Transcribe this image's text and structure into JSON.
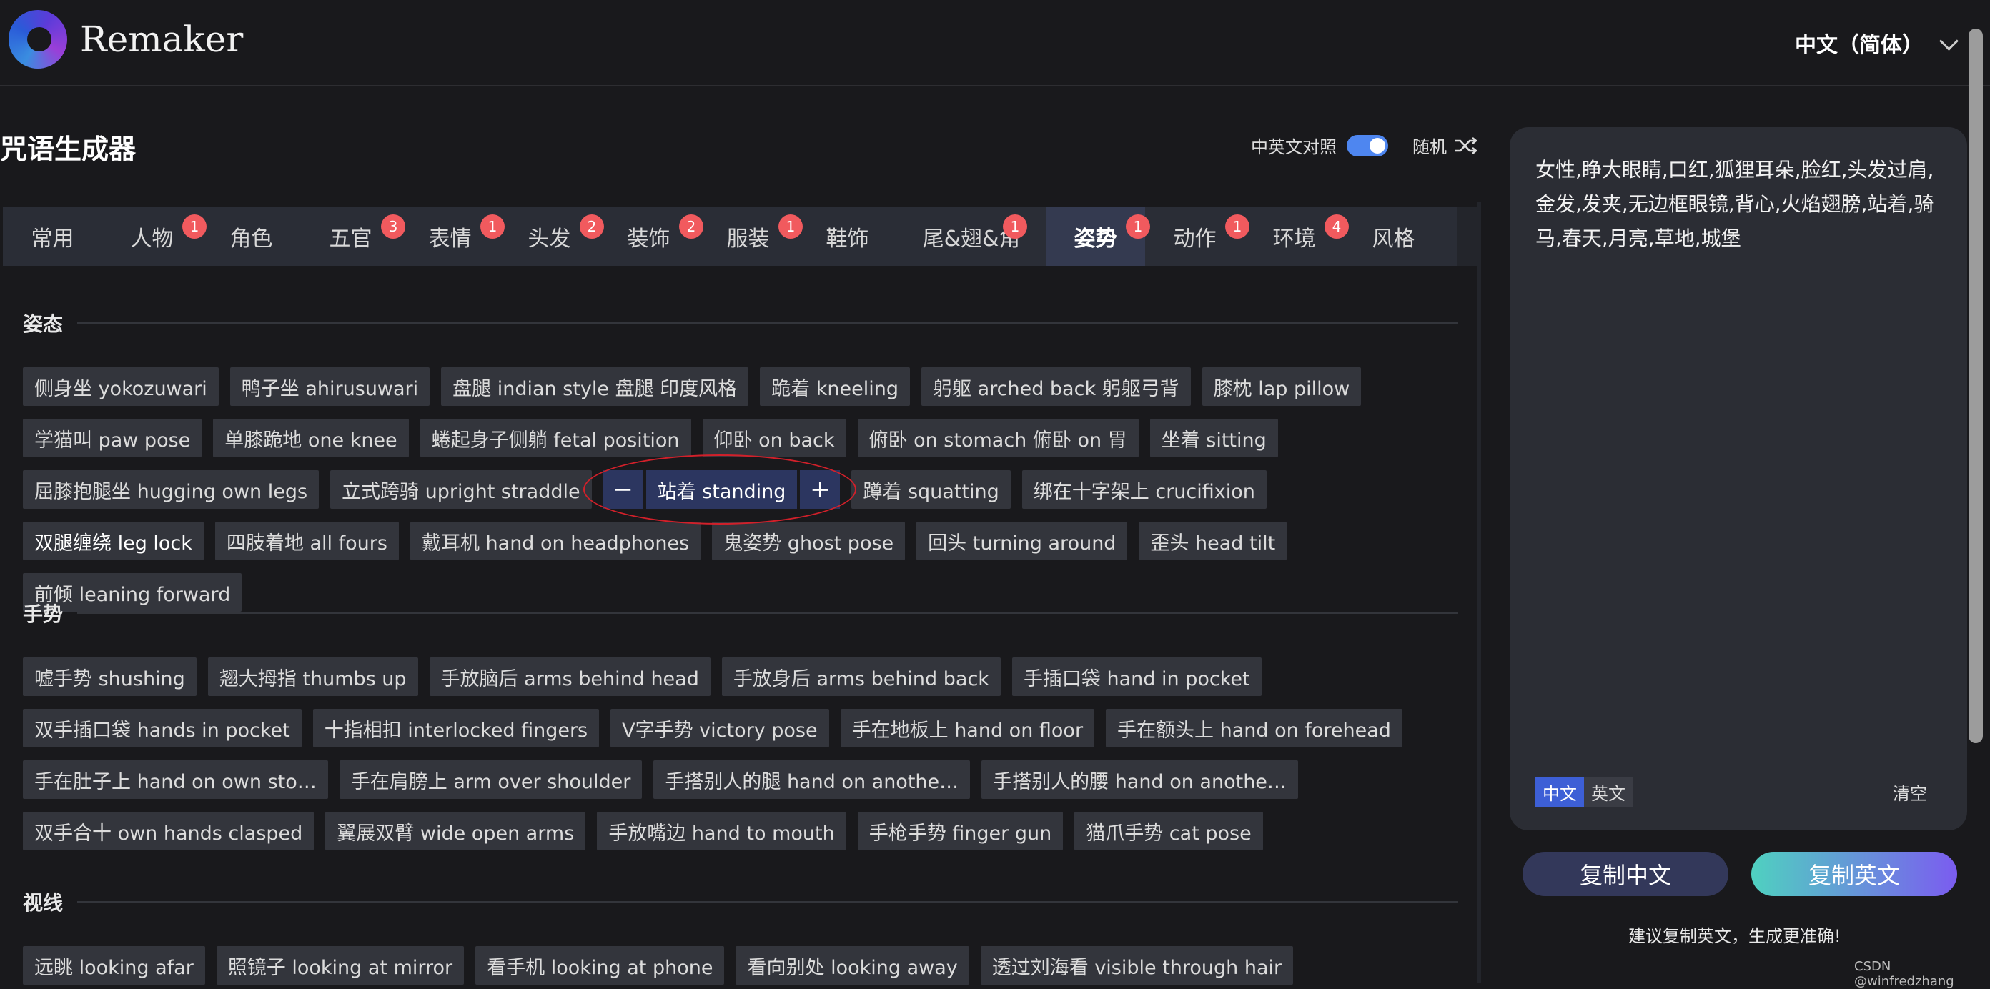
{
  "header": {
    "brand": "Remaker",
    "language": "中文（简体）"
  },
  "page_title": "咒语生成器",
  "controls": {
    "bilingual_label": "中英文对照",
    "bilingual_on": true,
    "random_label": "随机"
  },
  "tabs": [
    {
      "label": "常用",
      "badge": ""
    },
    {
      "label": "人物",
      "badge": "1"
    },
    {
      "label": "角色",
      "badge": ""
    },
    {
      "label": "五官",
      "badge": "3"
    },
    {
      "label": "表情",
      "badge": "1"
    },
    {
      "label": "头发",
      "badge": "2"
    },
    {
      "label": "装饰",
      "badge": "2"
    },
    {
      "label": "服装",
      "badge": "1"
    },
    {
      "label": "鞋饰",
      "badge": ""
    },
    {
      "label": "尾&翅&角",
      "badge": "1"
    },
    {
      "label": "姿势",
      "badge": "1"
    },
    {
      "label": "动作",
      "badge": "1"
    },
    {
      "label": "环境",
      "badge": "4"
    },
    {
      "label": "风格",
      "badge": ""
    }
  ],
  "active_tab": "姿势",
  "sections": [
    {
      "title": "姿态",
      "chips": [
        "侧身坐 yokozuwari",
        "鸭子坐 ahirusuwari",
        "盘腿 indian style  盘腿 印度风格",
        "跪着 kneeling",
        "躬躯 arched back  躬躯弓背",
        "膝枕 lap pillow",
        "学猫叫 paw pose",
        "单膝跪地 one knee",
        "蜷起身子侧躺 fetal position",
        "仰卧 on back",
        "俯卧 on stomach  俯卧 on 胃",
        "坐着 sitting",
        "屈膝抱腿坐 hugging own legs",
        "立式跨骑 upright straddle",
        "站着 standing",
        "蹲着 squatting",
        "绑在十字架上 crucifixion",
        "双腿缠绕 leg lock",
        "四肢着地 all fours",
        "戴耳机 hand on headphones",
        "鬼姿势 ghost pose",
        "回头 turning around",
        "歪头 head tilt",
        "前倾 leaning forward"
      ],
      "selected": "站着 standing",
      "highlighted": [
        "双腿缠绕 leg lock"
      ]
    },
    {
      "title": "手势",
      "chips": [
        "嘘手势 shushing",
        "翘大拇指 thumbs up",
        "手放脑后 arms behind head",
        "手放身后 arms behind back",
        "手插口袋 hand in pocket",
        "双手插口袋 hands in pocket",
        "十指相扣 interlocked fingers",
        "V字手势 victory pose",
        "手在地板上 hand on floor",
        "手在额头上 hand on forehead",
        "手在肚子上 hand on own sto…",
        "手在肩膀上 arm over shoulder",
        "手搭别人的腿 hand on anothe…",
        "手搭别人的腰 hand on anothe…",
        "双手合十 own hands clasped",
        "翼展双臂 wide open arms",
        "手放嘴边 hand to mouth",
        "手枪手势 finger gun",
        "猫爪手势 cat pose"
      ]
    },
    {
      "title": "视线",
      "chips": [
        "远眺 looking afar",
        "照镜子 looking at mirror",
        "看手机 looking at phone",
        "看向别处 looking away",
        "透过刘海看 visible through hair"
      ]
    }
  ],
  "selected_controls": {
    "minus": "−",
    "plus": "+"
  },
  "output": {
    "text": "女性,睁大眼睛,口红,狐狸耳朵,脸红,头发过肩,金发,发夹,无边框眼镜,背心,火焰翅膀,站着,骑马,春天,月亮,草地,城堡",
    "lang_cn": "中文",
    "lang_en": "英文",
    "clear": "清空"
  },
  "buttons": {
    "copy_cn": "复制中文",
    "copy_en": "复制英文"
  },
  "tip": "建议复制英文，生成更准确!",
  "watermark": "CSDN @winfredzhang",
  "colors": {
    "accent": "#4e86f0",
    "badge": "#f15a5e",
    "highlight_ring": "#d2202a"
  }
}
